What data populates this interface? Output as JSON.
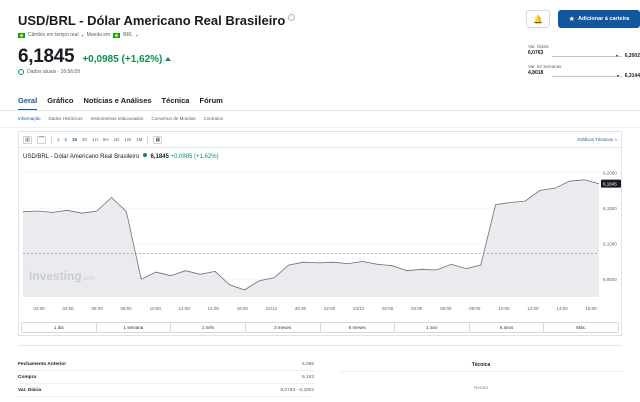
{
  "header": {
    "title": "USD/BRL - Dólar Americano Real Brasileiro",
    "sub_realtime": "Câmbio em tempo real",
    "sub_currency_label": "Moeda em",
    "sub_currency": "BRL",
    "price": "6,1845",
    "change": "+0,0985 (+1,62%)",
    "status": "Dados atuais · 16:56:09",
    "add_button": "Adicionar à carteira"
  },
  "ranges": [
    {
      "label": "Var. Diária",
      "low": "6,0763",
      "high": "6,2002",
      "position": 0.88
    },
    {
      "label": "Var. 52 semanas",
      "low": "4,8018",
      "high": "6,3144",
      "position": 0.91
    }
  ],
  "tabs": [
    "Geral",
    "Gráfico",
    "Notícias e Análises",
    "Técnica",
    "Fórum"
  ],
  "subtabs": [
    "Informação",
    "Dados Históricos",
    "Instrumentos relacionados",
    "Conversor de Moedas",
    "Contratos"
  ],
  "toolbar": {
    "timeframes": [
      "1",
      "5",
      "15",
      "30",
      "1H",
      "5H",
      "1D",
      "1W",
      "1M"
    ],
    "active": "15",
    "technical_link": "Gráficos Técnicos »"
  },
  "chart_head": {
    "name": "USD/BRL - Dólar Americano Real Brasileiro",
    "price": "6,1845",
    "change": "+0,0985 (+1,62%)"
  },
  "watermark": "Investing",
  "watermark_suffix": ".com",
  "current_label": "6,1845",
  "chart_data": {
    "type": "area",
    "x_ticks": [
      "02:00",
      "04:00",
      "06:00",
      "08:00",
      "10:00",
      "12:00",
      "14:00",
      "16:00",
      "22/12",
      "20:30",
      "22:00",
      "23/12",
      "02:00",
      "04:00",
      "06:00",
      "08:00",
      "10:00",
      "12:00",
      "14:00",
      "16:00"
    ],
    "y_ticks": [
      "6,2000",
      "6,1500",
      "6,1000",
      "6,0500"
    ],
    "ylim": [
      6.025,
      6.215
    ],
    "reference_line": 6.086,
    "x": [
      0,
      0.5,
      1,
      1.5,
      2,
      2.5,
      3,
      3.5,
      4,
      4.5,
      5,
      5.5,
      6,
      6.5,
      7,
      7.5,
      8,
      8.5,
      9,
      9.5,
      10,
      10.5,
      11,
      11.5,
      12,
      12.5,
      13,
      13.5,
      14,
      14.5,
      15,
      15.5,
      16,
      16.5,
      17,
      17.5,
      18,
      18.5,
      19,
      19.5
    ],
    "values": [
      6.145,
      6.146,
      6.144,
      6.147,
      6.143,
      6.146,
      6.165,
      6.145,
      6.05,
      6.06,
      6.055,
      6.062,
      6.057,
      6.061,
      6.042,
      6.035,
      6.048,
      6.052,
      6.07,
      6.074,
      6.073,
      6.074,
      6.072,
      6.075,
      6.071,
      6.069,
      6.062,
      6.064,
      6.063,
      6.071,
      6.065,
      6.07,
      6.155,
      6.158,
      6.16,
      6.175,
      6.178,
      6.188,
      6.19,
      6.1845
    ]
  },
  "periods": [
    "1 dia",
    "1 semana",
    "1 mês",
    "3 meses",
    "6 meses",
    "1 ano",
    "5 anos",
    "Máx."
  ],
  "stats": [
    {
      "k": "Fechamento Anterior",
      "v": "6,086"
    },
    {
      "k": "Compra",
      "v": "6,183"
    },
    {
      "k": "Var. Diária",
      "v": "6,0763 - 6,2002"
    }
  ],
  "technical": {
    "title": "Técnica",
    "value": "Neutro"
  },
  "colors": {
    "brand": "#1256a0",
    "positive": "#0a8f4b",
    "line": "#6a6f78",
    "fill": "#e9ebee"
  }
}
